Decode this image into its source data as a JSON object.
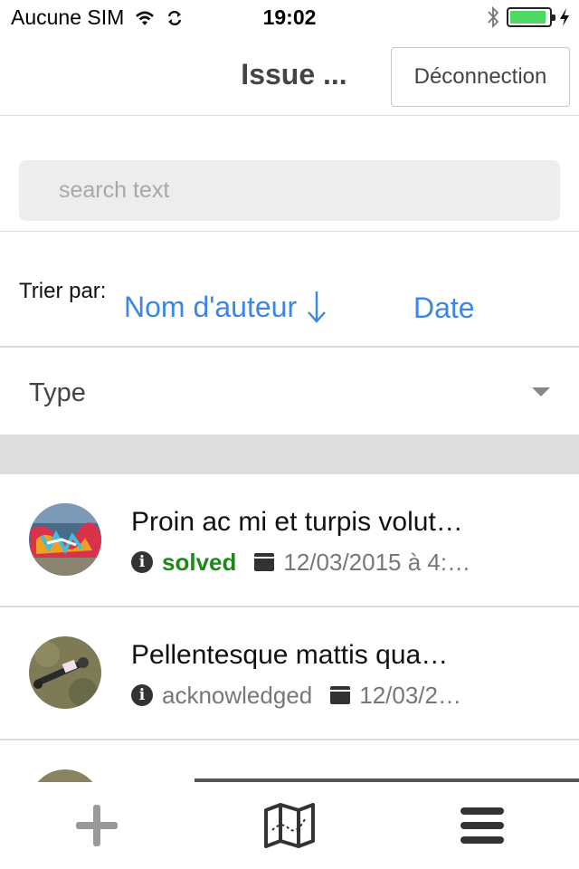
{
  "status_bar": {
    "carrier": "Aucune SIM",
    "time": "19:02",
    "battery_level": 0.92
  },
  "nav": {
    "title": "Issue ...",
    "logout_label": "Déconnection"
  },
  "search": {
    "placeholder": "search text",
    "value": ""
  },
  "sort": {
    "label": "Trier par:",
    "options": [
      {
        "label": "Nom d'auteur",
        "active": true,
        "direction": "descending"
      },
      {
        "label": "Date",
        "active": false
      }
    ]
  },
  "filter": {
    "type_label": "Type"
  },
  "issues": [
    {
      "title": "Proin ac mi et turpis volut…",
      "status": "solved",
      "date": "12/03/2015 à 4:…",
      "avatar": "graffiti"
    },
    {
      "title": "Pellentesque mattis qua…",
      "status": "acknowledged",
      "date": "12/03/2…",
      "avatar": "grass-object"
    }
  ],
  "tabbar": {
    "items": [
      "add-icon",
      "map-icon",
      "menu-icon"
    ]
  },
  "colors": {
    "accent_blue": "#3a87e8",
    "solved_green": "#1b8a1b",
    "battery_green": "#4cd964"
  }
}
